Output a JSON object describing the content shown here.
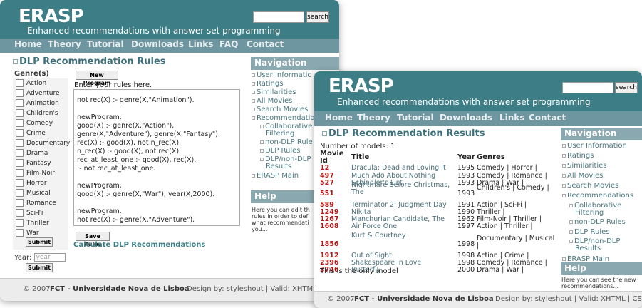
{
  "site": {
    "logo": "ERASP",
    "tagline": "Enhanced recommendations with answer set programming",
    "search_button": "search",
    "menu": [
      "Home",
      "Theory",
      "Tutorial",
      "Downloads",
      "Links",
      "FAQ",
      "Contact"
    ],
    "menu_front": [
      "Home",
      "Theory",
      "Tutorial",
      "Downloads",
      "Links",
      "Contact"
    ]
  },
  "rules_window": {
    "title": "DLP Recommendation Rules",
    "genres_header": "Genre(s)",
    "genres": [
      "Action",
      "Adventure",
      "Animation",
      "Children's",
      "Comedy",
      "Crime",
      "Documentary",
      "Drama",
      "Fantasy",
      "Film-Noir",
      "Horror",
      "Musical",
      "Romance",
      "Sci-Fi",
      "Thriller",
      "War"
    ],
    "submit_label": "Submit",
    "year_label": "Year:",
    "year_placeholder": "year",
    "year_submit": "Submit",
    "new_program_button": "New Program",
    "enter_rules_label": "Enter your rules here.",
    "rules_lines": [
      "not rec(X) :- genre(X,\"Animation\").",
      "",
      "newProgram.",
      "good(X) :- genre(X,\"Action\"),",
      "genre(X,\"Adventure\"), genre(X,\"Fantasy\").",
      "rec(X) :- good(X), not n_rec(X).",
      "n_rec(X) :- good(X), not rec(X).",
      "rec_at_least_one :- good(X), rec(X).",
      ":- not rec_at_least_one.",
      "",
      "newProgram.",
      "good(X) :- genre(X,\"War\"), year(X,2000).",
      "",
      "newProgram.",
      "not rec(X) :- genre(X,\"Adventure\")."
    ],
    "save_button": "Save Rules",
    "calc_link": "Calculate DLP Recommendations",
    "nav_title": "Navigation",
    "nav_items": [
      "User Informatic",
      "Ratings",
      "Similarities",
      "All Movies",
      "Search Movies",
      "Recommendatio",
      "Collaborative",
      "Filtering",
      "non-DLP Rule",
      "DLP Rules",
      "DLP/non-DLP",
      "Results",
      "ERASP Main"
    ],
    "help_title": "Help",
    "help_lines": [
      "Here you can edit th",
      "rules in order to def",
      "what recommendati",
      "you..."
    ],
    "footer_copy": "© 2007",
    "footer_org": "FCT - Universidade Nova de Lisboa",
    "footer_rest": "Design by: styleshout | Valid: XHTML |"
  },
  "results_window": {
    "title": "DLP Recommendation Results",
    "models_count": "Number of models: 1",
    "col_id": "Movie Id",
    "col_title": "Title",
    "col_year": "Year",
    "col_genres": "Genres",
    "rows": [
      {
        "id": "12",
        "title": "Dracula: Dead and Loving It",
        "year": "1995",
        "genres": "Comedy | Horror |"
      },
      {
        "id": "497",
        "title": "Much Ado About Nothing",
        "year": "1993",
        "genres": "Comedy | Romance |"
      },
      {
        "id": "527",
        "title": "Schindler's List",
        "year": "1993",
        "genres": "Drama | War |"
      },
      {
        "id": "551",
        "title": "Nightmare Before Christmas, The",
        "year": "1993",
        "genres": "Children's | Comedy |"
      },
      {
        "id": "589",
        "title": "Terminator 2: Judgment Day",
        "year": "1991",
        "genres": "Action | Sci-Fi |"
      },
      {
        "id": "1249",
        "title": "Nikita",
        "year": "1990",
        "genres": "Thriller |"
      },
      {
        "id": "1267",
        "title": "Manchurian Candidate, The",
        "year": "1962",
        "genres": "Film-Noir | Thriller |"
      },
      {
        "id": "1608",
        "title": "Air Force One",
        "year": "1997",
        "genres": "Action | Thriller |"
      },
      {
        "id": "1856",
        "title": "Kurt & Courtney",
        "year": "1998",
        "genres": "Documentary | Musical |"
      },
      {
        "id": "1912",
        "title": "Out of Sight",
        "year": "1998",
        "genres": "Action | Crime |"
      },
      {
        "id": "2396",
        "title": "Shakespeare in Love",
        "year": "1998",
        "genres": "Comedy | Romance |"
      },
      {
        "id": "3746",
        "title": "Butterfly",
        "year": "2000",
        "genres": "Drama | War |"
      }
    ],
    "only_model": "This is the only model",
    "nav_title": "Navigation",
    "nav_items": [
      "User Information",
      "Ratings",
      "Similarities",
      "All Movies",
      "Search Movies",
      "Recommendations",
      "Collaborative",
      "Filtering",
      "non-DLP Rules",
      "DLP Rules",
      "DLP/non-DLP",
      "Results",
      "ERASP Main"
    ],
    "help_title": "Help",
    "help_lines": [
      "Here you can see the new",
      "recommendations..."
    ],
    "footer_copy": "© 2007",
    "footer_org": "FCT - Universidade Nova de Lisboa",
    "footer_rest": "Design by: styleshout | Valid: XHTML | CSS"
  }
}
